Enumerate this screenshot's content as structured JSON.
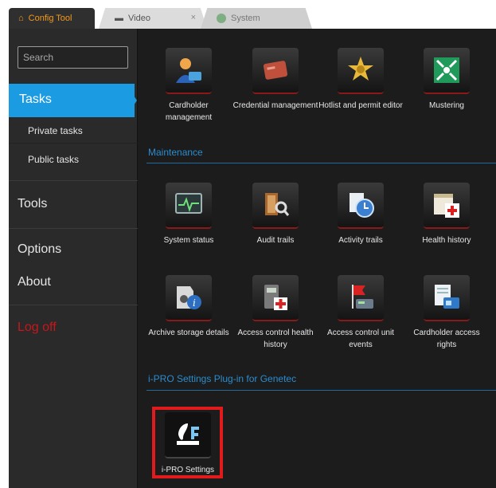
{
  "tabs": [
    {
      "label": "Config Tool",
      "icon": "home-icon"
    },
    {
      "label": "Video",
      "icon": "video-icon",
      "close": "×"
    },
    {
      "label": "System",
      "icon": "system-icon"
    }
  ],
  "sidebar": {
    "search_placeholder": "Search",
    "tasks": "Tasks",
    "private_tasks": "Private tasks",
    "public_tasks": "Public tasks",
    "tools": "Tools",
    "options": "Options",
    "about": "About",
    "logoff": "Log off"
  },
  "top_tiles": [
    {
      "label": "Cardholder management",
      "icon": "cardholder-icon"
    },
    {
      "label": "Credential management",
      "icon": "credential-icon"
    },
    {
      "label": "Hotlist and permit editor",
      "icon": "badge-icon"
    },
    {
      "label": "Mustering",
      "icon": "mustering-icon"
    }
  ],
  "sections": {
    "maintenance": "Maintenance",
    "ipro": "i-PRO Settings Plug-in for Genetec"
  },
  "maintenance_tiles": [
    {
      "label": "System status",
      "icon": "monitor-icon"
    },
    {
      "label": "Audit trails",
      "icon": "audit-icon"
    },
    {
      "label": "Activity trails",
      "icon": "clock-icon"
    },
    {
      "label": "Health history",
      "icon": "calendar-health-icon"
    },
    {
      "label": "Archive storage details",
      "icon": "archive-info-icon"
    },
    {
      "label": "Access control health history",
      "icon": "access-health-icon"
    },
    {
      "label": "Access control unit events",
      "icon": "flag-icon"
    },
    {
      "label": "Cardholder access rights",
      "icon": "access-rights-icon"
    }
  ],
  "ipro_tile": {
    "label": "i-PRO Settings",
    "icon": "ipro-settings-icon"
  },
  "colors": {
    "accent": "#1b9ce2",
    "logoff": "#c8161b",
    "highlight": "#e11b1b",
    "tab_active_text": "#f29a1c"
  }
}
